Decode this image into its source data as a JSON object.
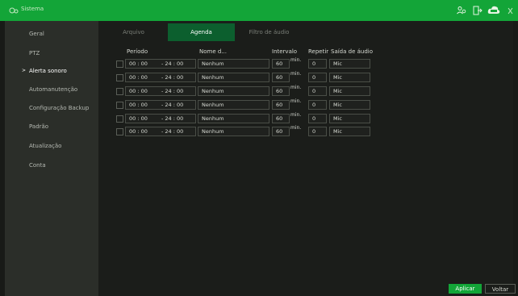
{
  "window": {
    "title": "Sistema"
  },
  "topbar_icons": [
    "users-icon",
    "logout-icon",
    "cloud-icon",
    "close-icon"
  ],
  "sidebar": {
    "items": [
      {
        "label": "Geral",
        "active": false
      },
      {
        "label": "PTZ",
        "active": false
      },
      {
        "label": "Alerta sonoro",
        "active": true
      },
      {
        "label": "Automanutenção",
        "active": false
      },
      {
        "label": "Configuração Backup",
        "active": false
      },
      {
        "label": "Padrão",
        "active": false
      },
      {
        "label": "Atualização",
        "active": false
      },
      {
        "label": "Conta",
        "active": false
      }
    ]
  },
  "tabs": [
    {
      "label": "Arquivo",
      "active": false
    },
    {
      "label": "Agenda",
      "active": true
    },
    {
      "label": "Filtro de áudio",
      "active": false
    }
  ],
  "table": {
    "headers": {
      "period": "Período",
      "name": "Nome d...",
      "interval": "Intervalo",
      "repeat": "Repetir",
      "output": "Saída de áudio"
    },
    "rows": [
      {
        "start": "00 : 00",
        "end": "- 24 : 00",
        "name": "Nenhum",
        "interval": "60",
        "unit": "min.",
        "repeat": "0",
        "output": "Mic"
      },
      {
        "start": "00 : 00",
        "end": "- 24 : 00",
        "name": "Nenhum",
        "interval": "60",
        "unit": "min.",
        "repeat": "0",
        "output": "Mic"
      },
      {
        "start": "00 : 00",
        "end": "- 24 : 00",
        "name": "Nenhum",
        "interval": "60",
        "unit": "min.",
        "repeat": "0",
        "output": "Mic"
      },
      {
        "start": "00 : 00",
        "end": "- 24 : 00",
        "name": "Nenhum",
        "interval": "60",
        "unit": "min.",
        "repeat": "0",
        "output": "Mic"
      },
      {
        "start": "00 : 00",
        "end": "- 24 : 00",
        "name": "Nenhum",
        "interval": "60",
        "unit": "min.",
        "repeat": "0",
        "output": "Mic"
      },
      {
        "start": "00 : 00",
        "end": "- 24 : 00",
        "name": "Nenhum",
        "interval": "60",
        "unit": "min.",
        "repeat": "0",
        "output": "Mic"
      }
    ]
  },
  "footer": {
    "apply": "Aplicar",
    "back": "Voltar"
  },
  "colors": {
    "accent": "#13a538",
    "tab_active": "#0c5f2e",
    "sidebar": "#2b2e29"
  }
}
